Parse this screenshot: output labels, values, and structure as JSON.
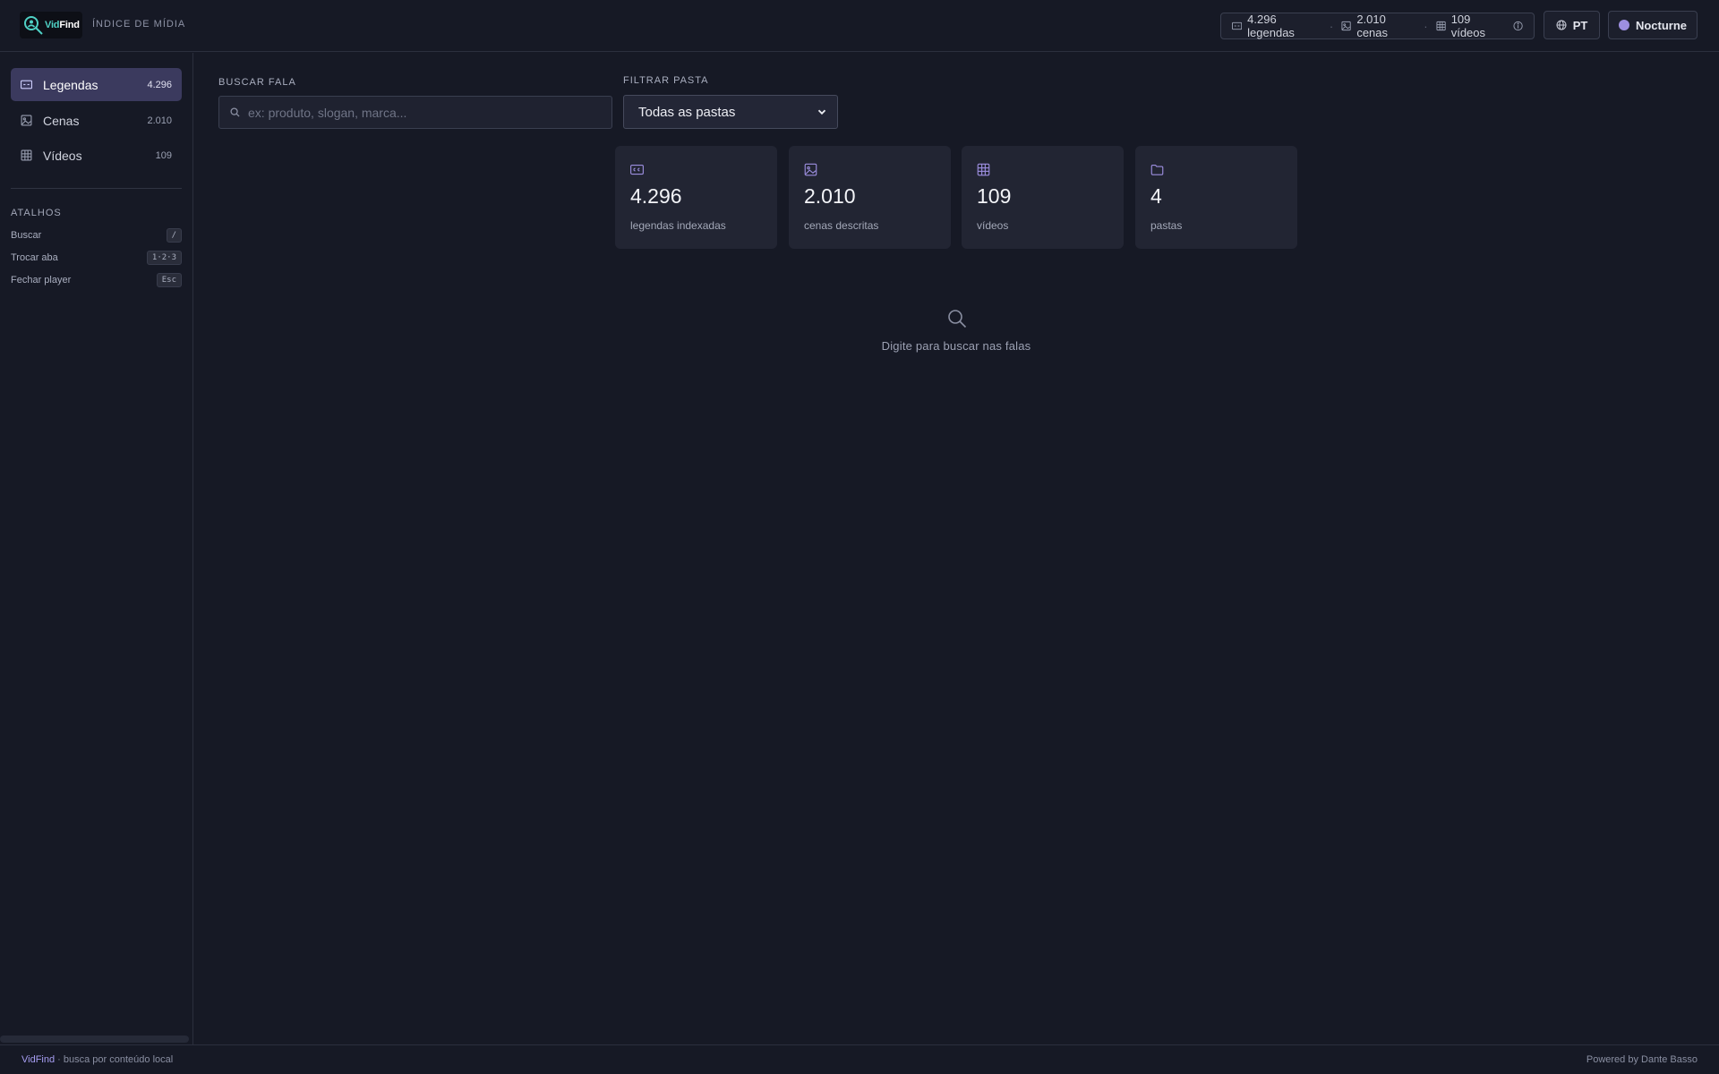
{
  "header": {
    "logo_text_a": "Vid",
    "logo_text_b": "Find",
    "subtitle": "ÍNDICE DE MÍDIA",
    "stats": {
      "subtitles": "4.296 legendas",
      "sep": "·",
      "scenes": "2.010 cenas",
      "videos": "109 vídeos"
    },
    "language_label": "PT",
    "theme_label": "Nocturne"
  },
  "sidebar": {
    "items": [
      {
        "label": "Legendas",
        "count": "4.296",
        "icon": "captions-icon"
      },
      {
        "label": "Cenas",
        "count": "2.010",
        "icon": "image-icon"
      },
      {
        "label": "Vídeos",
        "count": "109",
        "icon": "grid-icon"
      }
    ],
    "shortcuts_title": "ATALHOS",
    "shortcuts": [
      {
        "label": "Buscar",
        "key": "/"
      },
      {
        "label": "Trocar aba",
        "key": "1·2·3"
      },
      {
        "label": "Fechar player",
        "key": "Esc"
      }
    ]
  },
  "main": {
    "search_label": "BUSCAR FALA",
    "search_placeholder": "ex: produto, slogan, marca...",
    "search_value": "",
    "folder_label": "FILTRAR PASTA",
    "folder_selected": "Todas as pastas",
    "cards": [
      {
        "value": "4.296",
        "label": "legendas indexadas",
        "icon": "captions-icon"
      },
      {
        "value": "2.010",
        "label": "cenas descritas",
        "icon": "image-icon"
      },
      {
        "value": "109",
        "label": "vídeos",
        "icon": "grid-icon"
      },
      {
        "value": "4",
        "label": "pastas",
        "icon": "folder-icon"
      }
    ],
    "empty_message": "Digite para buscar nas falas"
  },
  "footer": {
    "brand": "VidFind",
    "tagline": " · busca por conteúdo local",
    "credit": "Powered by Dante Basso"
  },
  "colors": {
    "background": "#161925",
    "accent": "#9d8fe0",
    "active_nav": "#3b3a5e",
    "logo_accent": "#4fd1c5"
  }
}
